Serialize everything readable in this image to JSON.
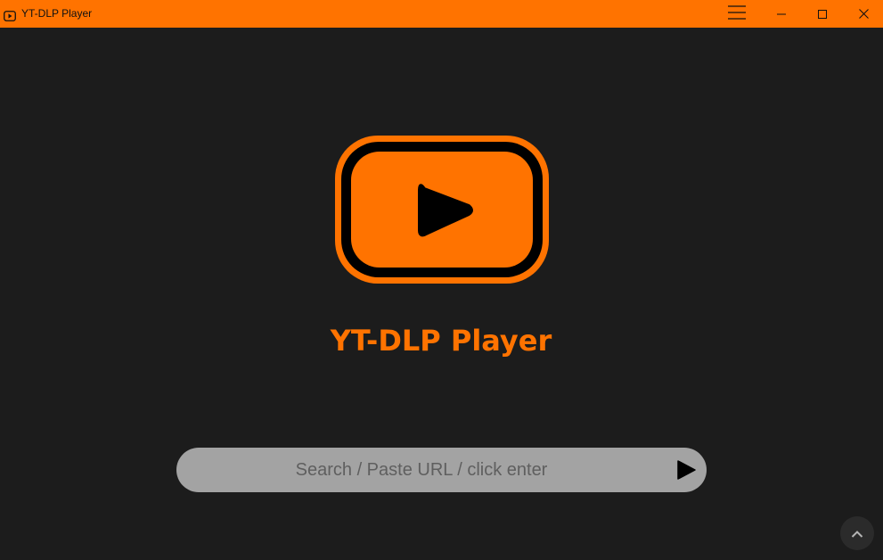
{
  "window": {
    "title": "YT-DLP Player",
    "accent_color": "#ff7300",
    "background_color": "#1c1c1c",
    "titlebar_icons": [
      "video-icon",
      "hamburger-menu-icon",
      "minimize-icon",
      "maximize-icon",
      "close-icon"
    ]
  },
  "hero": {
    "logo_icon": "play-button-icon",
    "title": "YT-DLP Player"
  },
  "search": {
    "placeholder": "Search / Paste URL / click enter",
    "value": "",
    "submit_icon": "play-icon"
  },
  "scroll_top": {
    "icon": "chevron-up-icon"
  }
}
